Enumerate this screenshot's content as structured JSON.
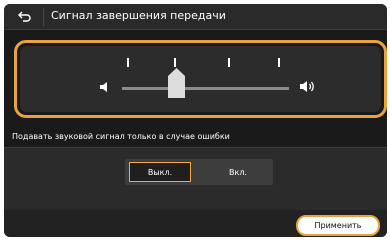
{
  "header": {
    "title": "Сигнал завершения передачи",
    "back_icon": "back-arrow-icon"
  },
  "volume": {
    "level_fraction": 0.4,
    "levels": 5,
    "min_icon": "speaker-low-icon",
    "max_icon": "speaker-high-icon"
  },
  "description": "Подавать звуковой сигнал только в случае ошибки",
  "options": {
    "off_label": "Выкл.",
    "on_label": "Вкл.",
    "selected": "off"
  },
  "footer": {
    "apply_label": "Применить"
  },
  "colors": {
    "accent": "#e8a33a",
    "background": "#1a1a1a"
  }
}
